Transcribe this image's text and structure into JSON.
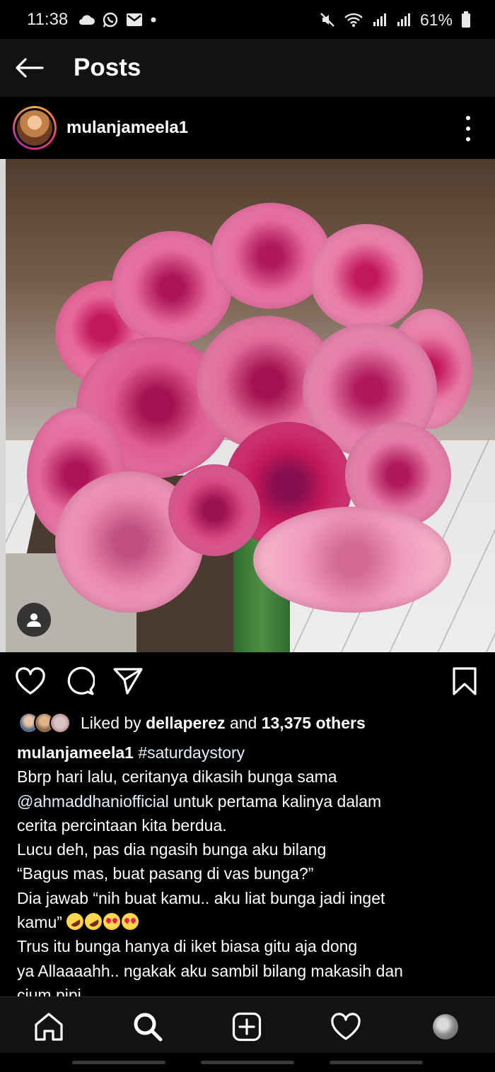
{
  "status_bar": {
    "time": "11:38",
    "battery": "61%",
    "left_icons": [
      "cloud-icon",
      "whatsapp-icon",
      "mail-icon",
      "dot-icon"
    ],
    "right_icons": [
      "mute-icon",
      "wifi-icon",
      "signal-icon",
      "signal-icon",
      "battery-icon"
    ]
  },
  "app_bar": {
    "title": "Posts",
    "back_icon": "arrow-left-icon"
  },
  "post": {
    "username": "mulanjameela1",
    "image_subject": "pink roses bouquet",
    "likes": {
      "prefix": "Liked by ",
      "liked_by_user": "dellaperez",
      "middle": " and ",
      "others": "13,375 others"
    },
    "caption": {
      "username": "mulanjameela1",
      "hashtag": "#saturdaystory",
      "line1": "Bbrp hari lalu, ceritanya dikasih bunga sama",
      "mention": "@ahmaddhaniofficial",
      "line2_rest": " untuk pertama kalinya dalam",
      "line3": "cerita percintaan kita berdua.",
      "line4": "Lucu deh, pas dia ngasih bunga aku bilang",
      "line5": "“Bagus mas, buat pasang di vas bunga?”",
      "line6": "Dia jawab “nih buat kamu.. aku liat bunga jadi inget",
      "line7": "kamu”",
      "line8": "Trus itu bunga hanya di iket biasa gitu aja dong",
      "line9": "ya Allaaaahh.. ngakak aku sambil bilang makasih dan",
      "line10": "cium pipi"
    }
  },
  "actions": [
    "heart-icon",
    "comment-icon",
    "share-icon",
    "bookmark-icon"
  ],
  "bottom_nav": [
    "home-icon",
    "search-icon",
    "add-post-icon",
    "activity-heart-icon",
    "profile-avatar"
  ],
  "colors": {
    "background": "#000000",
    "app_bar": "#121212",
    "text": "#ffffff",
    "mention": "#e0f1ff"
  }
}
